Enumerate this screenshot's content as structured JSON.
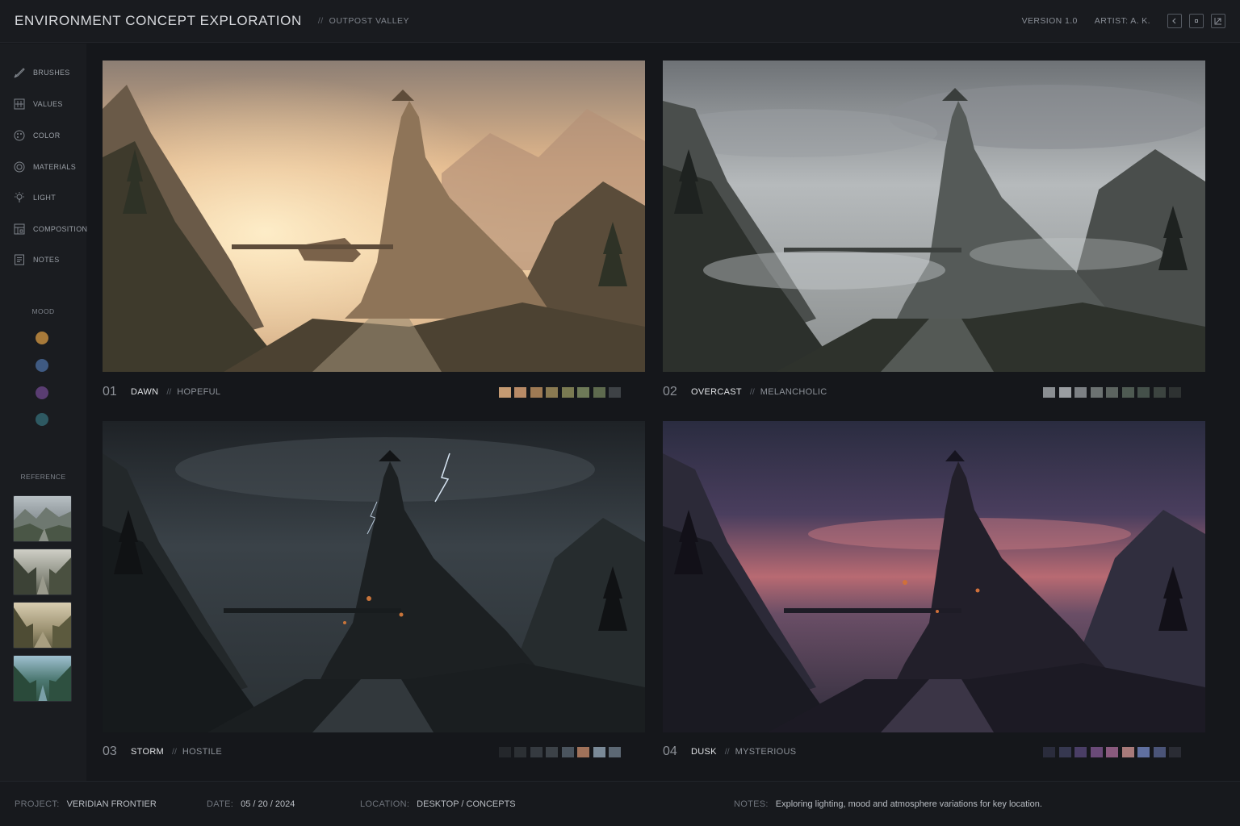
{
  "header": {
    "title": "ENVIRONMENT CONCEPT EXPLORATION",
    "subtitle_sep": "//",
    "subtitle": "OUTPOST VALLEY",
    "version": "VERSION 1.0",
    "artist": "ARTIST: A. K."
  },
  "sidebar": {
    "tools": [
      {
        "label": "BRUSHES",
        "icon": "brush-icon"
      },
      {
        "label": "VALUES",
        "icon": "values-icon"
      },
      {
        "label": "COLOR",
        "icon": "color-icon"
      },
      {
        "label": "MATERIALS",
        "icon": "materials-icon"
      },
      {
        "label": "LIGHT",
        "icon": "light-icon"
      },
      {
        "label": "COMPOSITION",
        "icon": "composition-icon"
      },
      {
        "label": "NOTES",
        "icon": "notes-icon"
      }
    ],
    "mood_label": "MOOD",
    "mood_colors": [
      "#a87a3a",
      "#3f5a82",
      "#5a3d72",
      "#2e5962"
    ],
    "reference_label": "REFERENCE"
  },
  "panels": [
    {
      "num": "01",
      "name": "DAWN",
      "sep": "//",
      "desc": "HOPEFUL",
      "palette": [
        "#c49a72",
        "#b88a66",
        "#9e7a54",
        "#8a7a52",
        "#7a7a52",
        "#6e7a58",
        "#5e6a4e",
        "#3e4246"
      ]
    },
    {
      "num": "02",
      "name": "OVERCAST",
      "sep": "//",
      "desc": "MELANCHOLIC",
      "palette": [
        "#8a8e92",
        "#9a9ea2",
        "#7c8084",
        "#6c7272",
        "#5c6460",
        "#4e5a52",
        "#44504a",
        "#3c4440",
        "#2e3232"
      ]
    },
    {
      "num": "03",
      "name": "STORM",
      "sep": "//",
      "desc": "HOSTILE",
      "palette": [
        "#24272b",
        "#2c3034",
        "#353a40",
        "#3c4248",
        "#4a545e",
        "#a0725a",
        "#7a8a98",
        "#5c6874"
      ]
    },
    {
      "num": "04",
      "name": "DUSK",
      "sep": "//",
      "desc": "MYSTERIOUS",
      "palette": [
        "#2a2c3c",
        "#363850",
        "#4a3e66",
        "#6a4a78",
        "#8a5a7e",
        "#a87a7a",
        "#6070a0",
        "#4a5478",
        "#2a2c34"
      ]
    }
  ],
  "footer": {
    "project_key": "PROJECT:",
    "project": "VERIDIAN FRONTIER",
    "date_key": "DATE:",
    "date": "05 / 20 / 2024",
    "location_key": "LOCATION:",
    "location": "DESKTOP / CONCEPTS",
    "notes_key": "NOTES:",
    "notes": "Exploring lighting, mood and atmosphere variations for key location."
  }
}
